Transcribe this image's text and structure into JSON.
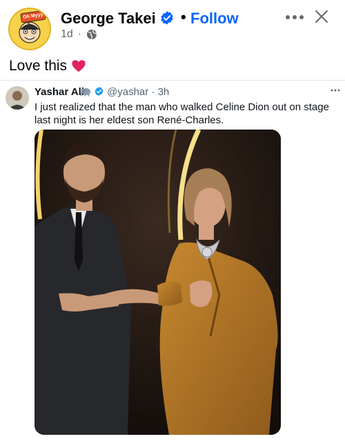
{
  "post": {
    "author_name": "George Takei",
    "separator": "•",
    "follow_label": "Follow",
    "time": "1d",
    "meta_separator": "·",
    "avatar_badge": "Oh Myyy",
    "caption": "Love this",
    "icons": {
      "verified": "verified-badge-icon",
      "globe": "globe-icon",
      "more": "more-icon",
      "close": "close-icon",
      "heart": "red-heart-icon"
    }
  },
  "tweet": {
    "author_name": "Yashar Ali",
    "handle_time": "@yashar · 3h",
    "text": "I just realized that the man who walked Celine Dion out on stage last night is her eldest son René-Charles.",
    "icons": {
      "emoji": "elephant-icon",
      "verified": "verified-badge-icon",
      "more": "more-icon"
    }
  },
  "colors": {
    "follow": "#0866ff",
    "verified": "#0866ff",
    "tweet_verified": "#1d9bf0",
    "heart": "#e0245e",
    "meta": "#65676b"
  }
}
